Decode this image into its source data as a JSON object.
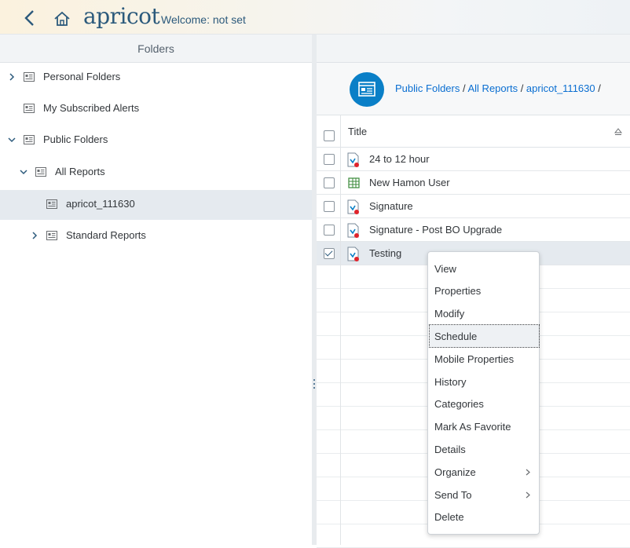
{
  "header": {
    "logo_text": "apricot",
    "welcome_text": "Welcome: not set"
  },
  "folders_pane": {
    "title": "Folders",
    "items": [
      {
        "label": "Personal Folders",
        "expanded": false,
        "has_children": true,
        "level": 0
      },
      {
        "label": "My Subscribed Alerts",
        "expanded": false,
        "has_children": false,
        "level": 0
      },
      {
        "label": "Public Folders",
        "expanded": true,
        "has_children": true,
        "level": 0
      },
      {
        "label": "All Reports",
        "expanded": true,
        "has_children": true,
        "level": 1
      },
      {
        "label": "apricot_111630",
        "selected": true,
        "has_children": false,
        "level": 2
      },
      {
        "label": "Standard Reports",
        "expanded": false,
        "has_children": true,
        "level": 2
      }
    ]
  },
  "breadcrumb": {
    "parts": [
      "Public Folders",
      "All Reports",
      "apricot_111630"
    ],
    "separator": "/"
  },
  "table": {
    "title_header": "Title",
    "rows": [
      {
        "title": "24 to 12 hour",
        "icon": "webi-report-icon",
        "checked": false
      },
      {
        "title": "New Hamon User",
        "icon": "spreadsheet-icon",
        "checked": false
      },
      {
        "title": "Signature",
        "icon": "webi-report-icon",
        "checked": false
      },
      {
        "title": "Signature - Post BO Upgrade",
        "icon": "webi-report-icon",
        "checked": false
      },
      {
        "title": "Testing",
        "icon": "webi-report-icon",
        "checked": true
      }
    ]
  },
  "context_menu": {
    "items": [
      {
        "label": "View"
      },
      {
        "label": "Properties"
      },
      {
        "label": "Modify"
      },
      {
        "label": "Schedule",
        "focused": true
      },
      {
        "label": "Mobile Properties"
      },
      {
        "label": "History"
      },
      {
        "label": "Categories"
      },
      {
        "label": "Mark As Favorite"
      },
      {
        "label": "Details"
      },
      {
        "label": "Organize",
        "submenu": true
      },
      {
        "label": "Send To",
        "submenu": true
      },
      {
        "label": "Delete"
      }
    ]
  },
  "colors": {
    "brand": "#2c5a7c",
    "link": "#0a6ed1",
    "selection": "#e5eaef",
    "accent_circle": "#0a7fc7"
  }
}
